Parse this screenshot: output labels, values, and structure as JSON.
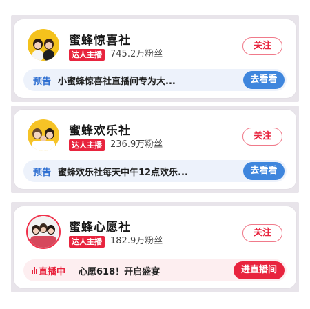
{
  "cards": [
    {
      "name": "蜜蜂惊喜社",
      "tag": "达人主播",
      "fans": "745.2万粉丝",
      "follow_label": "关注",
      "bar_label": "预告",
      "bar_text": "小蜜蜂惊喜社直播间专为大...",
      "bar_button": "去看看"
    },
    {
      "name": "蜜蜂欢乐社",
      "tag": "达人主播",
      "fans": "236.9万粉丝",
      "follow_label": "关注",
      "bar_label": "预告",
      "bar_text": "蜜蜂欢乐社每天中午12点欢乐...",
      "bar_button": "去看看"
    },
    {
      "name": "蜜蜂心愿社",
      "tag": "达人主播",
      "fans": "182.9万粉丝",
      "follow_label": "关注",
      "bar_label": "直播中",
      "bar_text": "心愿618！开启盛宴",
      "bar_button": "进直播间"
    }
  ],
  "colors": {
    "accent_red": "#e8243e",
    "accent_blue": "#3f86dd",
    "preview_bar_bg": "#edf2fb",
    "live_bar_bg": "#fdeef0"
  }
}
